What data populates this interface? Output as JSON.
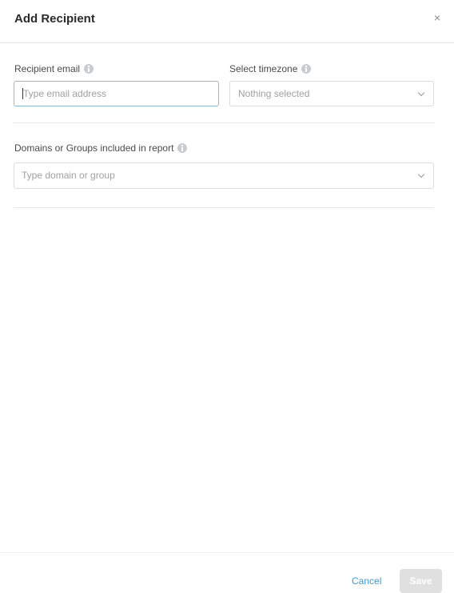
{
  "dialog": {
    "title": "Add Recipient",
    "close_label": "×"
  },
  "form": {
    "recipient_email": {
      "label": "Recipient email",
      "placeholder": "Type email address",
      "value": ""
    },
    "timezone": {
      "label": "Select timezone",
      "selected": "Nothing selected"
    },
    "domains": {
      "label": "Domains or Groups included in report",
      "placeholder": "Type domain or group"
    }
  },
  "footer": {
    "cancel_label": "Cancel",
    "save_label": "Save"
  },
  "colors": {
    "link": "#3d9bd3",
    "disabled_button": "#e0e0e0",
    "focus_border": "#8fb8dc"
  },
  "icons": [
    "close-icon",
    "info-icon",
    "chevron-down-icon"
  ]
}
